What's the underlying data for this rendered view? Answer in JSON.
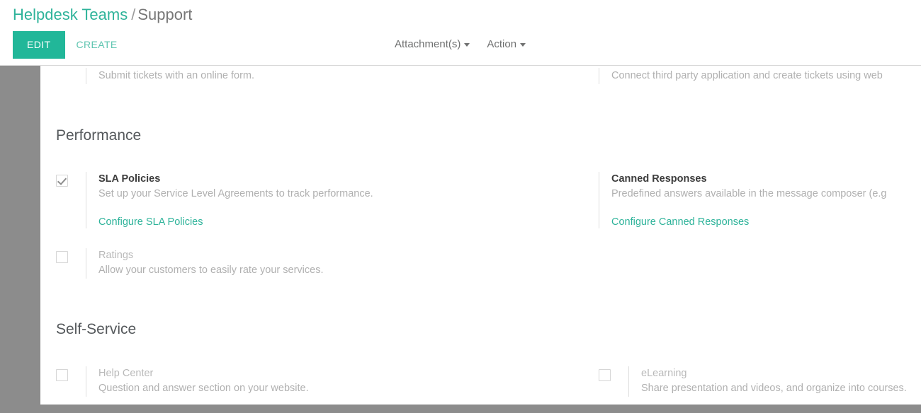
{
  "header": {
    "breadcrumb": {
      "root": "Helpdesk Teams",
      "separator": "/",
      "current": "Support"
    },
    "buttons": {
      "edit": "EDIT",
      "create": "CREATE"
    },
    "menus": [
      {
        "label": "Attachment(s)",
        "icon": "chevron-down-icon"
      },
      {
        "label": "Action",
        "icon": "chevron-down-icon"
      }
    ]
  },
  "colors": {
    "accent": "#21b799",
    "link": "#2eb39a",
    "create_button_text": "#5ec5b0",
    "section_heading": "#55595c",
    "muted_text": "#b0b0b0",
    "chrome_gray": "#8c8c8c"
  },
  "content": {
    "clipped_top_row": {
      "left": {
        "description": "Submit tickets with an online form."
      },
      "right": {
        "description": "Connect third party application and create tickets using web"
      }
    },
    "sections": [
      {
        "title": "Performance",
        "rows": [
          {
            "left": {
              "checkbox": {
                "present": true,
                "checked": true
              },
              "title": "SLA Policies",
              "description": "Set up your Service Level Agreements to track performance.",
              "link": "Configure SLA Policies"
            },
            "right": {
              "checkbox": {
                "present": false,
                "checked": false
              },
              "title": "Canned Responses",
              "description": "Predefined answers available in the message composer (e.g",
              "link": "Configure Canned Responses"
            }
          },
          {
            "left": {
              "checkbox": {
                "present": true,
                "checked": false
              },
              "title": "Ratings",
              "description": "Allow your customers to easily rate your services.",
              "link": ""
            },
            "right": null
          }
        ]
      },
      {
        "title": "Self-Service",
        "rows": [
          {
            "left": {
              "checkbox": {
                "present": true,
                "checked": false
              },
              "title": "Help Center",
              "description": "Question and answer section on your website.",
              "link": ""
            },
            "right": {
              "checkbox": {
                "present": true,
                "checked": false
              },
              "title": "eLearning",
              "description": "Share presentation and videos, and organize into courses.",
              "link": ""
            }
          }
        ]
      }
    ]
  }
}
